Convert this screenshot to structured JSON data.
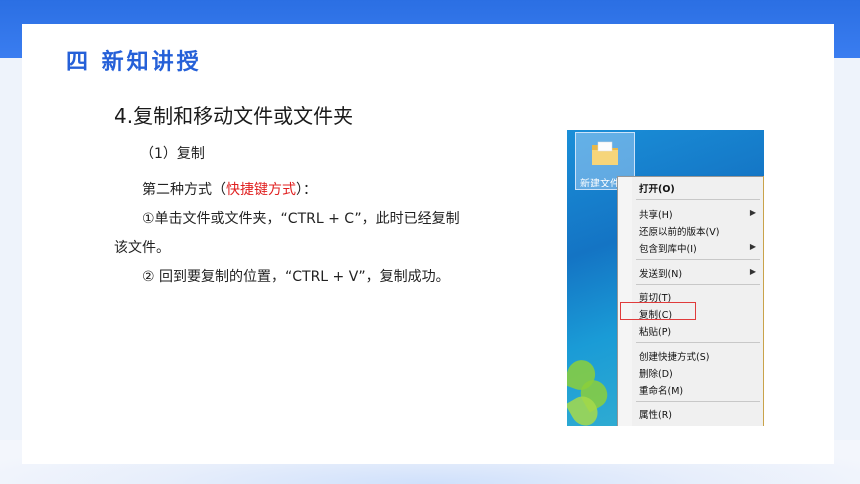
{
  "section_title": "四 新知讲授",
  "heading": "4.复制和移动文件或文件夹",
  "subheading": "（1）复制",
  "method_prefix": "第二种方式（",
  "method_highlight": "快捷键方式",
  "method_suffix": "）：",
  "step1_line1": "①单击文件或文件夹，“CTRL + C”，此时已经复制",
  "step1_line2": "该文件。",
  "step2": "② 回到要复制的位置，“CTRL + V”，复制成功。",
  "folder_label": "新建文件夹",
  "context_menu": {
    "open": "打开(O)",
    "share": "共享(H)",
    "restore": "还原以前的版本(V)",
    "include": "包含到库中(I)",
    "send_to": "发送到(N)",
    "cut": "剪切(T)",
    "copy": "复制(C)",
    "paste": "粘贴(P)",
    "shortcut": "创建快捷方式(S)",
    "delete": "删除(D)",
    "rename": "重命名(M)",
    "properties": "属性(R)",
    "submenu_arrow": "▶"
  },
  "colors": {
    "accent": "#2560d8",
    "highlight": "#e02020",
    "band": "#2b6fe3"
  }
}
